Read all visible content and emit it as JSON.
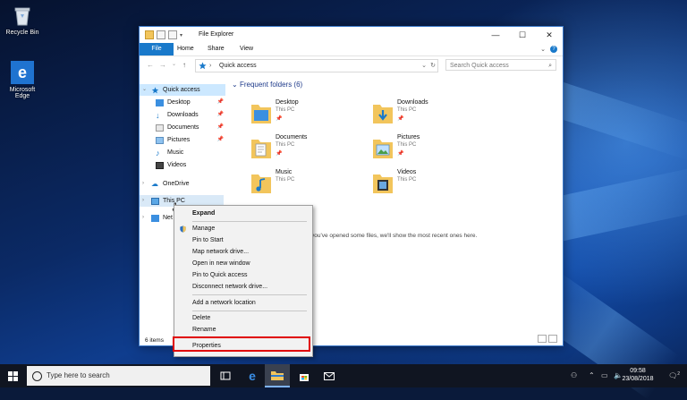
{
  "desktop": {
    "icons": [
      {
        "name": "recycle-bin",
        "label": "Recycle Bin"
      },
      {
        "name": "microsoft-edge",
        "label": "Microsoft Edge"
      }
    ]
  },
  "window": {
    "title": "File Explorer",
    "ribbon_tabs": [
      "File",
      "Home",
      "Share",
      "View"
    ],
    "address": "Quick access",
    "search_placeholder": "Search Quick access",
    "section_title": "Frequent folders (6)",
    "nav": [
      {
        "label": "Quick access",
        "selected": true
      },
      {
        "label": "Desktop",
        "pinned": true
      },
      {
        "label": "Downloads",
        "pinned": true
      },
      {
        "label": "Documents",
        "pinned": true
      },
      {
        "label": "Pictures",
        "pinned": true
      },
      {
        "label": "Music"
      },
      {
        "label": "Videos"
      },
      {
        "label": "OneDrive"
      },
      {
        "label": "This PC"
      },
      {
        "label": "Net"
      }
    ],
    "folders": [
      {
        "name": "Desktop",
        "location": "This PC"
      },
      {
        "name": "Downloads",
        "location": "This PC"
      },
      {
        "name": "Documents",
        "location": "This PC"
      },
      {
        "name": "Pictures",
        "location": "This PC"
      },
      {
        "name": "Music",
        "location": "This PC"
      },
      {
        "name": "Videos",
        "location": "This PC"
      }
    ],
    "recent_message": "you've opened some files, we'll show the most recent ones here.",
    "status": "6 items"
  },
  "context_menu": {
    "items": [
      "Expand",
      "Manage",
      "Pin to Start",
      "Map network drive...",
      "Open in new window",
      "Pin to Quick access",
      "Disconnect network drive...",
      "Add a network location",
      "Delete",
      "Rename",
      "Properties"
    ],
    "highlighted": "Properties"
  },
  "taskbar": {
    "search_placeholder": "Type here to search",
    "time": "09:58",
    "date": "23/08/2018",
    "notification_count": "2"
  },
  "colors": {
    "accent": "#1979ca",
    "selection": "#cce8ff",
    "highlight_border": "#e00000",
    "folder": "#f2c55c"
  }
}
